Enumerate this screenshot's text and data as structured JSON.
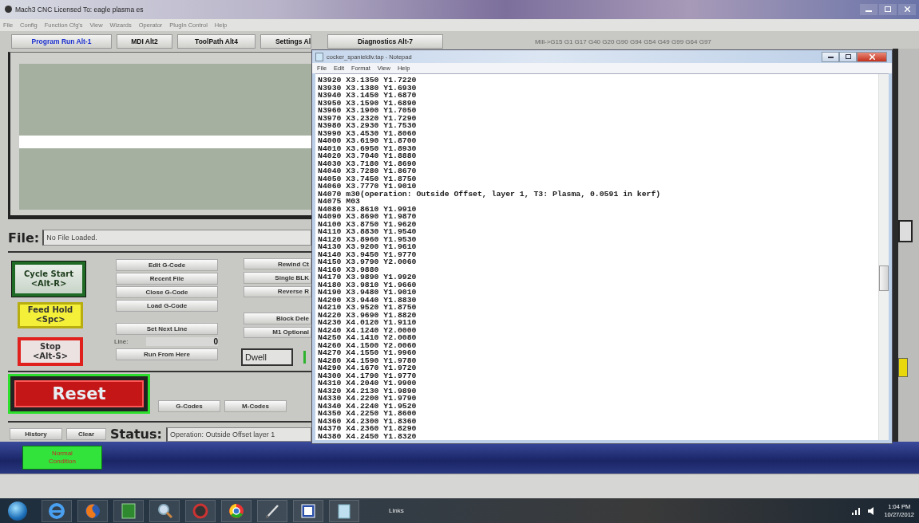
{
  "window": {
    "title": "Mach3 CNC  Licensed To: eagle plasma es"
  },
  "menu": [
    "File",
    "Config",
    "Function Cfg's",
    "View",
    "Wizards",
    "Operator",
    "PlugIn Control",
    "Help"
  ],
  "tabs": [
    {
      "label": "Program Run Alt-1",
      "selected": true
    },
    {
      "label": "MDI Alt2",
      "selected": false
    },
    {
      "label": "ToolPath Alt4",
      "selected": false
    },
    {
      "label": "Settings Al",
      "selected": false
    },
    {
      "label": "Diagnostics Alt-7",
      "selected": false
    }
  ],
  "modal_line": "Mill->G15  G1 G17 G40 G20 G90 G94 G54 G49 G99 G64 G97",
  "file": {
    "label": "File:",
    "value": "No File Loaded."
  },
  "run_buttons": [
    {
      "kind": "start",
      "label": "Cycle Start",
      "shortcut": "<Alt-R>"
    },
    {
      "kind": "hold",
      "label": "Feed Hold",
      "shortcut": "<Spc>"
    },
    {
      "kind": "stop",
      "label": "Stop",
      "shortcut": "<Alt-S>"
    }
  ],
  "file_buttons": [
    "Edit G-Code",
    "Recent File",
    "Close G-Code",
    "Load G-Code"
  ],
  "set_next_line": "Set Next Line",
  "line": {
    "label": "Line:",
    "value": "0"
  },
  "run_from_here": "Run From Here",
  "option_buttons": [
    "Rewind Ct",
    "Single BLK",
    "Reverse R",
    "Block Dele",
    "M1 Optional"
  ],
  "dwell": "Dwell",
  "reset": "Reset",
  "code_buttons": [
    "G-Codes",
    "M-Codes"
  ],
  "status": {
    "history": "History",
    "clear": "Clear",
    "label": "Status:",
    "value": "Operation: Outside Offset  layer 1"
  },
  "condition": "Normal Condition",
  "notepad": {
    "title": "cocker_spanieldiv.tap - Notepad",
    "menu": [
      "File",
      "Edit",
      "Format",
      "View",
      "Help"
    ],
    "lines": [
      "N3920 X3.1350 Y1.7220",
      "N3930 X3.1380 Y1.6930",
      "N3940 X3.1450 Y1.6870",
      "N3950 X3.1590 Y1.6890",
      "N3960 X3.1900 Y1.7050",
      "N3970 X3.2320 Y1.7290",
      "N3980 X3.2930 Y1.7530",
      "N3990 X3.4530 Y1.8060",
      "N4000 X3.6190 Y1.8700",
      "N4010 X3.6950 Y1.8930",
      "N4020 X3.7040 Y1.8880",
      "N4030 X3.7180 Y1.8690",
      "N4040 X3.7280 Y1.8670",
      "N4050 X3.7450 Y1.8750",
      "N4060 X3.7770 Y1.9010",
      "N4070 m30(operation: Outside Offset, layer 1, T3: Plasma, 0.0591 in kerf)",
      "N4075 M03",
      "N4080 X3.8610 Y1.9910",
      "N4090 X3.8690 Y1.9870",
      "N4100 X3.8750 Y1.9620",
      "N4110 X3.8830 Y1.9540",
      "N4120 X3.8960 Y1.9530",
      "N4130 X3.9200 Y1.9610",
      "N4140 X3.9450 Y1.9770",
      "N4150 X3.9790 Y2.0060",
      "N4160 X3.9880",
      "N4170 X3.9890 Y1.9920",
      "N4180 X3.9810 Y1.9660",
      "N4190 X3.9480 Y1.9010",
      "N4200 X3.9440 Y1.8830",
      "N4210 X3.9520 Y1.8750",
      "N4220 X3.9690 Y1.8820",
      "N4230 X4.0120 Y1.9110",
      "N4240 X4.1240 Y2.0000",
      "N4250 X4.1410 Y2.0080",
      "N4260 X4.1500 Y2.0060",
      "N4270 X4.1550 Y1.9960",
      "N4280 X4.1590 Y1.9780",
      "N4290 X4.1670 Y1.9720",
      "N4300 X4.1790 Y1.9770",
      "N4310 X4.2040 Y1.9900",
      "N4320 X4.2130 Y1.9890",
      "N4330 X4.2200 Y1.9790",
      "N4340 X4.2240 Y1.9520",
      "N4350 X4.2250 Y1.8600",
      "N4360 X4.2300 Y1.8360",
      "N4370 X4.2360 Y1.8290",
      "N4380 X4.2450 Y1.8320"
    ]
  },
  "taskbar": {
    "toolbar": "Links",
    "time": "1:04 PM",
    "date": "10/27/2012"
  }
}
